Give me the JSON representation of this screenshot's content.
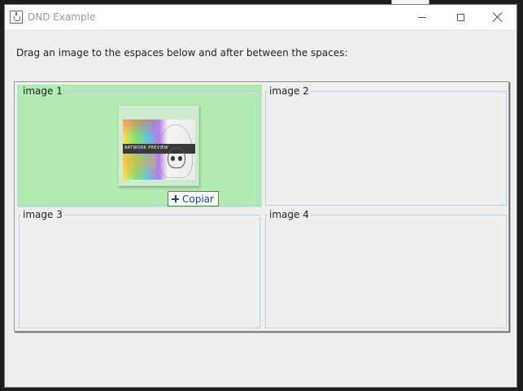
{
  "window": {
    "title": "DND Example",
    "icon": "java-app-icon",
    "controls": [
      "minimize-icon",
      "maximize-icon",
      "close-icon"
    ]
  },
  "instruction": "Drag an image to the espaces below and after between the spaces:",
  "cells": [
    {
      "label": "image 1",
      "highlighted": true,
      "highlight_color": "#b2ebb2"
    },
    {
      "label": "image 2",
      "highlighted": false
    },
    {
      "label": "image 3",
      "highlighted": false
    },
    {
      "label": "image 4",
      "highlighted": false
    }
  ],
  "drag": {
    "tooltip": "Copiar",
    "tooltip_icon": "plus-icon",
    "thumbnail": "dragged-image-thumbnail"
  },
  "colors": {
    "drop_highlight": "#b2ebb2",
    "tooltip_text": "#1c3f8f",
    "cell_border": "#b8cfe0"
  }
}
